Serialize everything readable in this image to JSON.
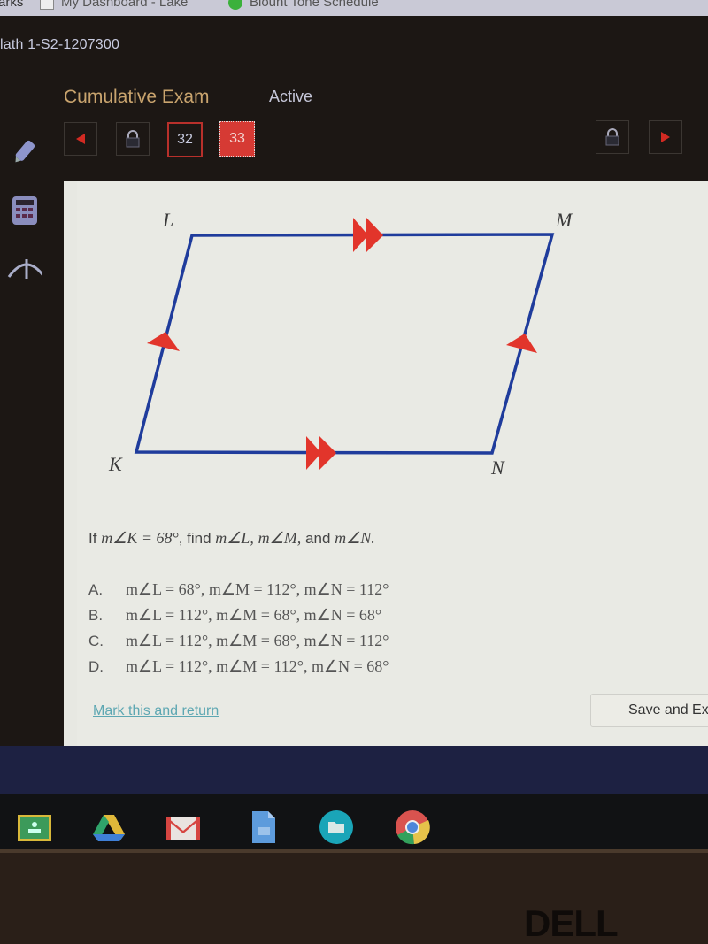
{
  "browser": {
    "bookmarks": [
      {
        "label": "arks",
        "icon": "bookmark-folder-icon"
      },
      {
        "label": "My Dashboard - Lake",
        "icon": "dashboard-favicon"
      },
      {
        "label": "Blount Tone Schedule",
        "icon": "green-favicon"
      }
    ]
  },
  "course": {
    "title": "lath 1-S2-1207300"
  },
  "exam": {
    "title": "Cumulative Exam",
    "status": "Active",
    "nav": {
      "prev_icon": "previous-arrow-icon",
      "lock_icon": "lock-icon",
      "next_icon": "next-arrow-icon",
      "questions": [
        {
          "number": "32",
          "state": "answered"
        },
        {
          "number": "33",
          "state": "current"
        }
      ]
    },
    "tools": [
      {
        "name": "pencil",
        "icon": "pencil-icon"
      },
      {
        "name": "calculator",
        "icon": "calculator-icon"
      },
      {
        "name": "reference",
        "icon": "compass-icon"
      }
    ]
  },
  "figure": {
    "shape": "parallelogram",
    "vertices": {
      "top_left": "L",
      "top_right": "M",
      "bottom_left": "K",
      "bottom_right": "N"
    },
    "marks": {
      "LM_KN": "double arrow (parallel)",
      "KL_NM": "single arrow (parallel)"
    },
    "colors": {
      "edge": "#1f3c9c",
      "marker": "#e2352b"
    }
  },
  "question": {
    "prefix": "If",
    "given": "m∠K = 68°",
    "middle": ", find",
    "find1": "m∠L,",
    "find2": "m∠M,",
    "conj": "and",
    "find3": "m∠N."
  },
  "choices": [
    {
      "letter": "A.",
      "text": "m∠L = 68°, m∠M = 112°, m∠N = 112°"
    },
    {
      "letter": "B.",
      "text": "m∠L = 112°, m∠M = 68°, m∠N = 68°"
    },
    {
      "letter": "C.",
      "text": "m∠L = 112°, m∠M = 68°, m∠N = 112°"
    },
    {
      "letter": "D.",
      "text": "m∠L = 112°, m∠M = 112°, m∠N = 68°"
    }
  ],
  "footer": {
    "mark_link": "Mark this and return",
    "save_button": "Save and Exit"
  },
  "shelf": {
    "apps": [
      {
        "name": "Google Classroom",
        "icon": "classroom-icon"
      },
      {
        "name": "Google Drive",
        "icon": "drive-icon"
      },
      {
        "name": "Gmail",
        "icon": "gmail-icon"
      },
      {
        "name": "Google Docs",
        "icon": "docs-icon"
      },
      {
        "name": "Files",
        "icon": "files-icon"
      },
      {
        "name": "Chrome",
        "icon": "chrome-icon"
      }
    ]
  },
  "hardware": {
    "brand": "DELL"
  }
}
